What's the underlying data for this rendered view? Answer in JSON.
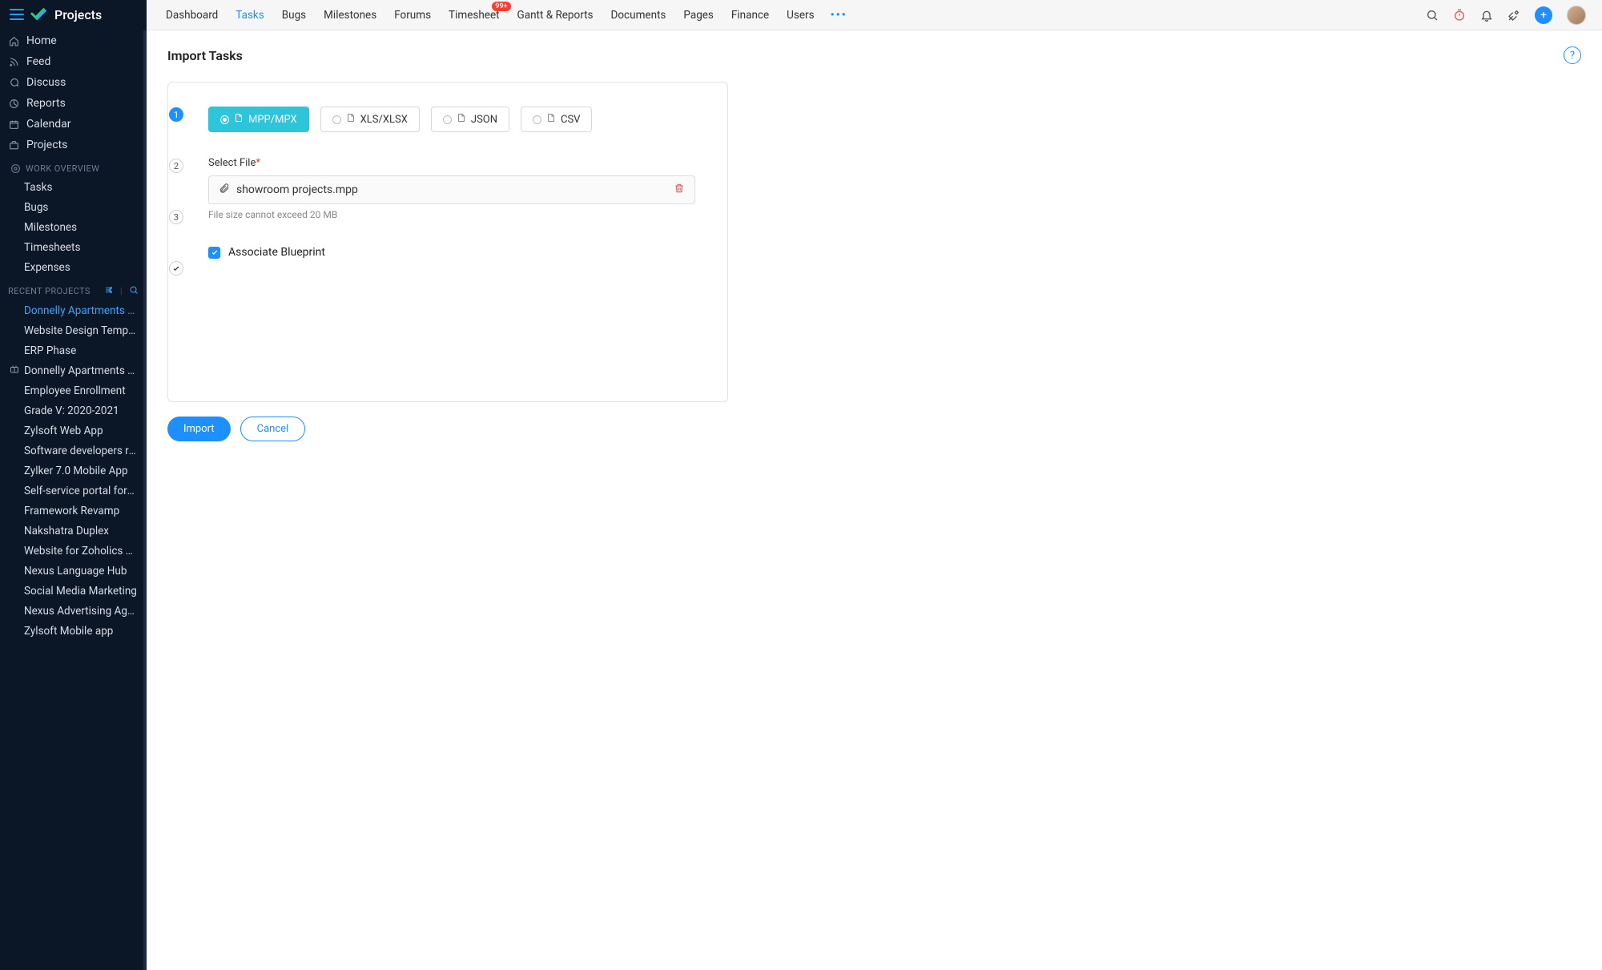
{
  "brand": "Projects",
  "sidebar": {
    "nav": [
      {
        "label": "Home"
      },
      {
        "label": "Feed"
      },
      {
        "label": "Discuss"
      },
      {
        "label": "Reports"
      },
      {
        "label": "Calendar"
      },
      {
        "label": "Projects"
      }
    ],
    "work_overview_label": "WORK OVERVIEW",
    "work_items": [
      {
        "label": "Tasks"
      },
      {
        "label": "Bugs"
      },
      {
        "label": "Milestones"
      },
      {
        "label": "Timesheets"
      },
      {
        "label": "Expenses"
      }
    ],
    "recent_label": "RECENT PROJECTS",
    "recent": [
      {
        "label": "Donnelly Apartments Construction",
        "active": true
      },
      {
        "label": "Website Design Templates"
      },
      {
        "label": "ERP Phase"
      },
      {
        "label": "Donnelly Apartments Construction",
        "icon": true
      },
      {
        "label": "Employee Enrollment"
      },
      {
        "label": "Grade V: 2020-2021"
      },
      {
        "label": "Zylsoft Web App"
      },
      {
        "label": "Software developers recruitment"
      },
      {
        "label": "Zylker 7.0 Mobile App"
      },
      {
        "label": "Self-service portal for Zylker"
      },
      {
        "label": "Framework Revamp"
      },
      {
        "label": "Nakshatra Duplex"
      },
      {
        "label": "Website for Zoholics event"
      },
      {
        "label": "Nexus Language Hub"
      },
      {
        "label": "Social Media Marketing"
      },
      {
        "label": "Nexus Advertising Agency"
      },
      {
        "label": "Zylsoft Mobile app"
      }
    ]
  },
  "topnav": [
    {
      "label": "Dashboard"
    },
    {
      "label": "Tasks",
      "active": true
    },
    {
      "label": "Bugs"
    },
    {
      "label": "Milestones"
    },
    {
      "label": "Forums"
    },
    {
      "label": "Timesheet",
      "badge": "99+"
    },
    {
      "label": "Gantt & Reports"
    },
    {
      "label": "Documents"
    },
    {
      "label": "Pages"
    },
    {
      "label": "Finance"
    },
    {
      "label": "Users"
    }
  ],
  "page": {
    "title": "Import Tasks",
    "formats": [
      {
        "label": "MPP/MPX",
        "active": true
      },
      {
        "label": "XLS/XLSX"
      },
      {
        "label": "JSON"
      },
      {
        "label": "CSV"
      }
    ],
    "select_file_label": "Select File",
    "file_name": "showroom projects.mpp",
    "file_hint": "File size cannot exceed 20 MB",
    "assoc_label": "Associate Blueprint",
    "steps": [
      "1",
      "2",
      "3"
    ],
    "import_btn": "Import",
    "cancel_btn": "Cancel",
    "help": "?"
  }
}
